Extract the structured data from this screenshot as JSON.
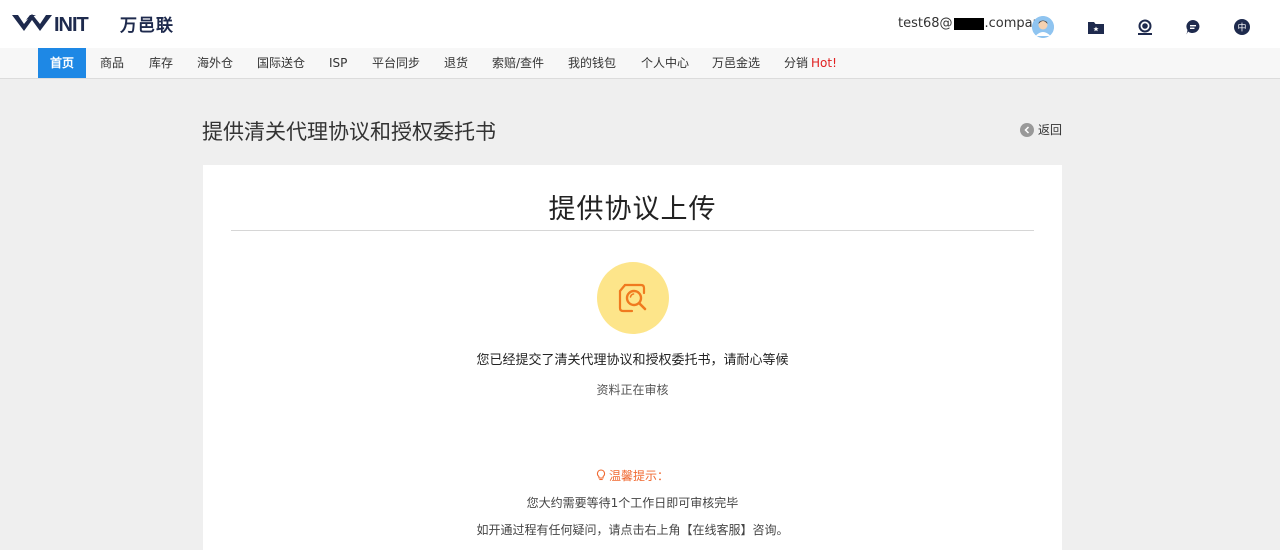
{
  "header": {
    "logo_text": "万邑联",
    "user_email_prefix": "test68@",
    "user_email_suffix": ".company",
    "icons": [
      "folder-icon",
      "support-icon",
      "chat-icon",
      "language-icon"
    ],
    "language_label": "中"
  },
  "nav": {
    "items": [
      {
        "label": "首页"
      },
      {
        "label": "商品"
      },
      {
        "label": "库存"
      },
      {
        "label": "海外仓"
      },
      {
        "label": "国际送仓"
      },
      {
        "label": "ISP"
      },
      {
        "label": "平台同步"
      },
      {
        "label": "退货"
      },
      {
        "label": "索赔/查件"
      },
      {
        "label": "我的钱包"
      },
      {
        "label": "个人中心"
      },
      {
        "label": "万邑金选"
      },
      {
        "label": "分销"
      }
    ],
    "hot_badge": "Hot!"
  },
  "page": {
    "title": "提供清关代理协议和授权委托书",
    "back_label": "返回"
  },
  "card": {
    "title": "提供协议上传",
    "main_message": "您已经提交了清关代理协议和授权委托书，请耐心等候",
    "sub_message": "资料正在审核",
    "tip_title": "温馨提示：",
    "tip_lines": [
      "您大约需要等待1个工作日即可审核完毕",
      "如开通过程有任何疑问，请点击右上角【在线客服】咨询。"
    ]
  },
  "colors": {
    "brand_navy": "#1e2a4d",
    "nav_active": "#1e88e5",
    "hot_red": "#e02020",
    "tip_orange": "#f06a32",
    "status_yellow": "#fde58a"
  }
}
